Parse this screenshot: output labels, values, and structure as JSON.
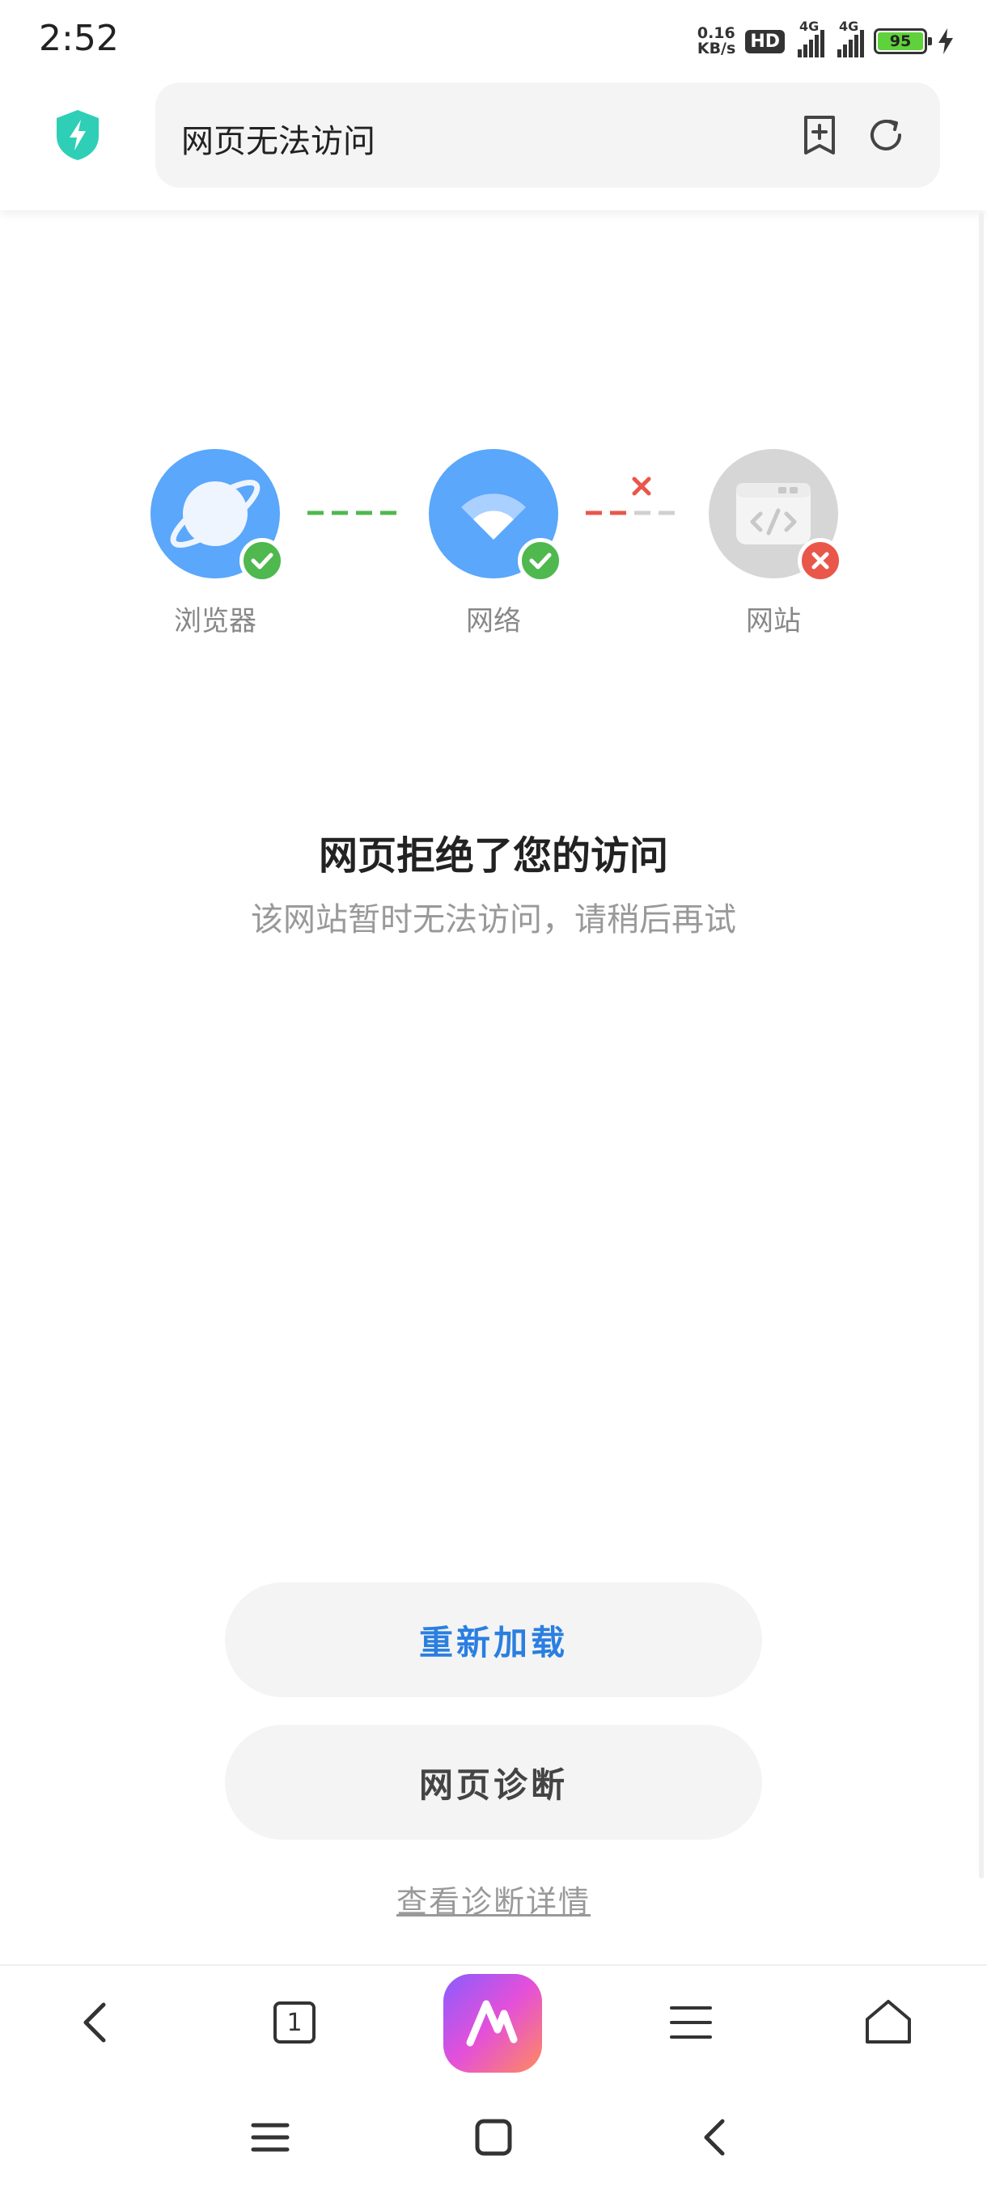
{
  "status_bar": {
    "time": "2:52",
    "net_speed_value": "0.16",
    "net_speed_unit": "KB/s",
    "hd_label": "HD",
    "sim1_label": "4G",
    "sim2_label": "4G",
    "battery_level": "95",
    "battery_color": "#5fd13a"
  },
  "address_bar": {
    "page_title": "网页无法访问",
    "shield_color": "#2ecfb6"
  },
  "diagram": {
    "nodes": [
      {
        "label": "浏览器",
        "status": "ok",
        "icon": "planet-icon"
      },
      {
        "label": "网络",
        "status": "ok",
        "icon": "wifi-icon"
      },
      {
        "label": "网站",
        "status": "error",
        "icon": "code-window-icon"
      }
    ],
    "colors": {
      "ok_node": "#5aa7fb",
      "error_node": "#d6d6d6",
      "ok_badge": "#4fb84f",
      "error_badge": "#e9574a"
    }
  },
  "message": {
    "title": "网页拒绝了您的访问",
    "subtitle": "该网站暂时无法访问，请稍后再试"
  },
  "actions": {
    "reload_label": "重新加载",
    "diagnose_label": "网页诊断",
    "detail_link": "查看诊断详情",
    "accent_color": "#2a7fe0"
  },
  "toolbar": {
    "tab_count": "1",
    "items": [
      "back-icon",
      "tabs-icon",
      "ai-assistant-icon",
      "menu-icon",
      "home-icon"
    ]
  },
  "navbar": {
    "items": [
      "recent-apps-icon",
      "home-square-icon",
      "nav-back-icon"
    ]
  }
}
